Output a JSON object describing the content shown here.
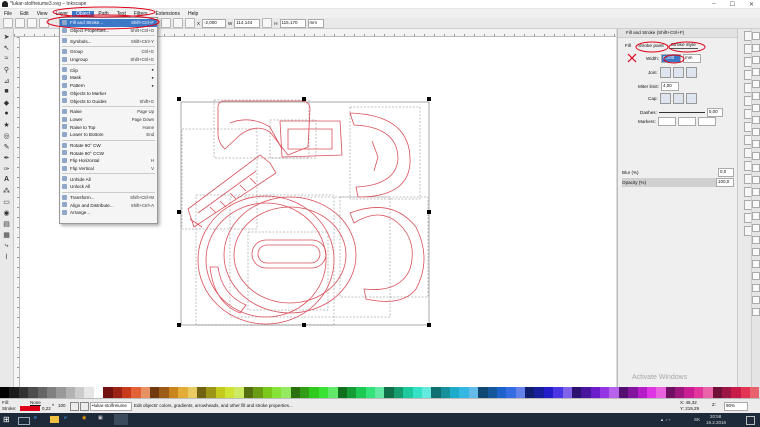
{
  "window": {
    "title": "*lukar-stolfreiume3.svg – Inkscape",
    "controls": [
      "–",
      "☐",
      "✕"
    ]
  },
  "menubar": {
    "items": [
      "File",
      "Edit",
      "View",
      "Layer",
      "Object",
      "Path",
      "Text",
      "Filters",
      "Extensions",
      "Help"
    ],
    "active": "Object"
  },
  "toolbar": {
    "x_value": "-2,000",
    "y_label": "W",
    "y_value": "114,144",
    "h_label": "H",
    "h_value": "115,170",
    "unit": "mm"
  },
  "object_menu": [
    {
      "label": "Fill and Stroke...",
      "shortcut": "Shift+Ctrl+F",
      "highlighted": true
    },
    {
      "label": "Object Properties...",
      "shortcut": "Shift+Ctrl+O"
    },
    {
      "sep": true
    },
    {
      "label": "Symbols...",
      "shortcut": "Shift+Ctrl+Y"
    },
    {
      "sep": true
    },
    {
      "label": "Group",
      "shortcut": "Ctrl+G"
    },
    {
      "label": "Ungroup",
      "shortcut": "Shift+Ctrl+G"
    },
    {
      "sep": true
    },
    {
      "label": "Clip",
      "shortcut": "▸"
    },
    {
      "label": "Mask",
      "shortcut": "▸"
    },
    {
      "label": "Pattern",
      "shortcut": "▸"
    },
    {
      "label": "Objects to Marker",
      "shortcut": ""
    },
    {
      "label": "Objects to Guides",
      "shortcut": "Shift+G"
    },
    {
      "sep": true
    },
    {
      "label": "Raise",
      "shortcut": "Page Up"
    },
    {
      "label": "Lower",
      "shortcut": "Page Down"
    },
    {
      "label": "Raise to Top",
      "shortcut": "Home"
    },
    {
      "label": "Lower to Bottom",
      "shortcut": "End"
    },
    {
      "sep": true
    },
    {
      "label": "Rotate 90° CW",
      "shortcut": ""
    },
    {
      "label": "Rotate 90° CCW",
      "shortcut": ""
    },
    {
      "label": "Flip Horizontal",
      "shortcut": "H"
    },
    {
      "label": "Flip Vertical",
      "shortcut": "V"
    },
    {
      "sep": true
    },
    {
      "label": "Unhide All",
      "shortcut": ""
    },
    {
      "label": "Unlock All",
      "shortcut": ""
    },
    {
      "sep": true
    },
    {
      "label": "Transform...",
      "shortcut": "Shift+Ctrl+M"
    },
    {
      "label": "Align and Distribute...",
      "shortcut": "Shift+Ctrl+A"
    },
    {
      "label": "Arrange...",
      "shortcut": ""
    }
  ],
  "panel": {
    "title": "Fill and Stroke (Shift+Ctrl+F)",
    "tabs": [
      "Fill",
      "Stroke paint",
      "Stroke style"
    ],
    "width_label": "Width:",
    "width_value": "0,100",
    "width_unit": "mm",
    "join_label": "Join:",
    "miter_label": "Miter limit:",
    "miter_value": "4,00",
    "cap_label": "Cap:",
    "dashes_label": "Dashes:",
    "dashes_value": "0,00",
    "markers_label": "Markers:",
    "blur_label": "Blur (%)",
    "blur_value": "0,0",
    "opacity_label": "Opacity (%)",
    "opacity_value": "100,0"
  },
  "status": {
    "fill_label": "Fill:",
    "fill_value": "None",
    "stroke_label": "Stroke:",
    "stroke_width": "0,22",
    "opacity": "100",
    "layer": "•lukar-stolfreiume",
    "message": "Edit objects' colors, gradients, arrowheads, and other fill and stroke properties...",
    "coord_x": "X: 45,32",
    "coord_y": "Y: 219,29",
    "zoom": "90%"
  },
  "taskbar": {
    "clock_time": "20:58",
    "clock_date": "16.2.2016",
    "lang": "SK"
  },
  "watermark": "Activate Windows",
  "colors": {
    "accent": "#3c78c8",
    "cut_line": "#d9505a",
    "annotation": "#e0001a"
  }
}
